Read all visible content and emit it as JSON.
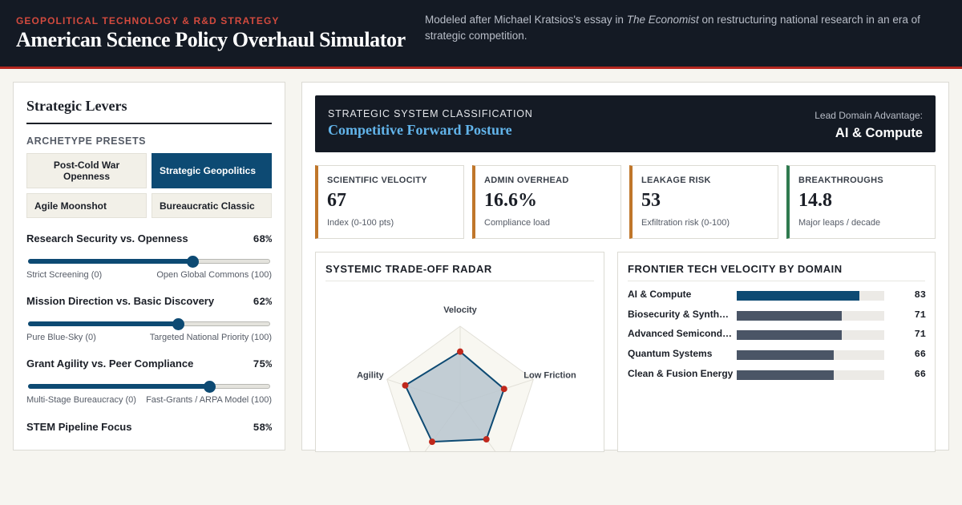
{
  "header": {
    "kicker": "GEOPOLITICAL TECHNOLOGY & R&D STRATEGY",
    "title": "American Science Policy Overhaul Simulator",
    "desc_pre": "Modeled after Michael Kratsios's essay in ",
    "desc_source": "The Economist",
    "desc_post": " on restructuring national research in an era of strategic competition."
  },
  "levers_panel": {
    "title": "Strategic Levers",
    "presets_label": "ARCHETYPE PRESETS",
    "presets": [
      {
        "label": "Post-Cold War Openness",
        "active": false
      },
      {
        "label": "Strategic Geopolitics",
        "active": true
      },
      {
        "label": "Agile Moonshot",
        "active": false
      },
      {
        "label": "Bureaucratic Classic",
        "active": false
      }
    ],
    "levers": [
      {
        "name": "Research Security vs. Openness",
        "value": 68,
        "display": "68%",
        "min_label": "Strict Screening (0)",
        "max_label": "Open Global Commons (100)"
      },
      {
        "name": "Mission Direction vs. Basic Discovery",
        "value": 62,
        "display": "62%",
        "min_label": "Pure Blue-Sky (0)",
        "max_label": "Targeted National Priority (100)"
      },
      {
        "name": "Grant Agility vs. Peer Compliance",
        "value": 75,
        "display": "75%",
        "min_label": "Multi-Stage Bureaucracy (0)",
        "max_label": "Fast-Grants / ARPA Model (100)"
      },
      {
        "name": "STEM Pipeline Focus",
        "value": 58,
        "display": "58%",
        "min_label": "",
        "max_label": ""
      }
    ]
  },
  "classification": {
    "label": "STRATEGIC SYSTEM CLASSIFICATION",
    "value": "Competitive Forward Posture",
    "lead_label": "Lead Domain Advantage:",
    "lead_value": "AI & Compute"
  },
  "kpis": [
    {
      "label": "SCIENTIFIC VELOCITY",
      "value": "67",
      "sub": "Index (0-100 pts)",
      "accent": "#c0762a"
    },
    {
      "label": "ADMIN OVERHEAD",
      "value": "16.6%",
      "sub": "Compliance load",
      "accent": "#c0762a"
    },
    {
      "label": "LEAKAGE RISK",
      "value": "53",
      "sub": "Exfiltration risk (0-100)",
      "accent": "#c0762a"
    },
    {
      "label": "BREAKTHROUGHS",
      "value": "14.8",
      "sub": "Major leaps / decade",
      "accent": "#2f7a4f"
    }
  ],
  "radar": {
    "title": "SYSTEMIC TRADE-OFF RADAR",
    "axes": [
      "Velocity",
      "Low Friction",
      "",
      "",
      "Agility"
    ],
    "values": [
      67,
      60,
      58,
      62,
      75
    ],
    "max": 100
  },
  "domains": {
    "title": "FRONTIER TECH VELOCITY BY DOMAIN",
    "rows": [
      {
        "name": "AI & Compute",
        "value": 83
      },
      {
        "name": "Biosecurity & Synthetic Biology",
        "value": 71
      },
      {
        "name": "Advanced Semiconductors",
        "value": 71
      },
      {
        "name": "Quantum Systems",
        "value": 66
      },
      {
        "name": "Clean & Fusion Energy",
        "value": 66
      }
    ]
  },
  "colors": {
    "accent_navy": "#0d4a73",
    "accent_red": "#b3261e",
    "radar_fill": "#b9c6cf",
    "radar_dot": "#c0281c"
  }
}
